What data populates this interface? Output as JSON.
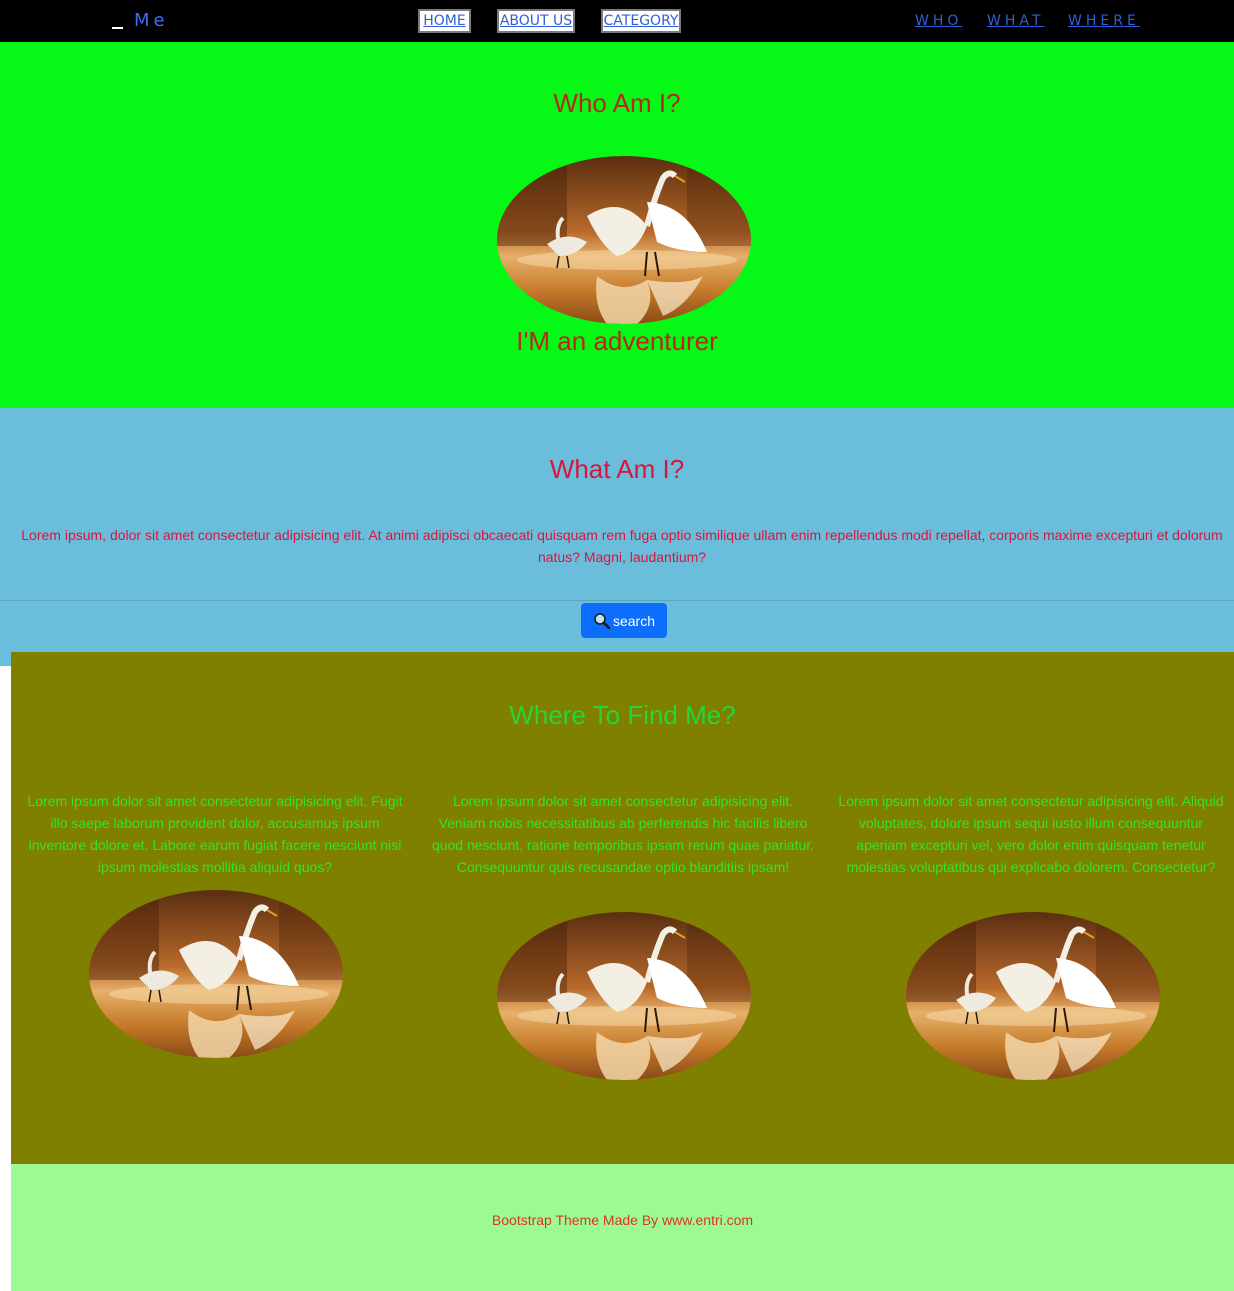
{
  "navbar": {
    "brand": "Me",
    "buttons": [
      "HOME",
      "ABOUT US",
      "CATEGORY"
    ],
    "links": [
      "WHO",
      "WHAT",
      "WHERE"
    ]
  },
  "who": {
    "heading": "Who Am I?",
    "image": "egrets-oval-image",
    "tagline": "I'M an adventurer"
  },
  "what": {
    "heading": "What Am I?",
    "text": "Lorem ipsum, dolor sit amet consectetur adipisicing elit. At animi adipisci obcaecati quisquam rem fuga optio similique ullam enim repellendus modi repellat, corporis maxime excepturi et dolorum natus? Magni, laudantium?",
    "search_label": "search",
    "search_icon": "magnifier-icon"
  },
  "where": {
    "heading": "Where To Find Me?",
    "columns": [
      {
        "text": "Lorem ipsum dolor sit amet consectetur adipisicing elit. Fugit illo saepe laborum provident dolor, accusamus ipsum inventore dolore et. Labore earum fugiat facere nesciunt nisi ipsum molestias mollitia aliquid quos?"
      },
      {
        "text": "Lorem ipsum dolor sit amet consectetur adipisicing elit. Veniam nobis necessitatibus ab perferendis hic facilis libero quod nesciunt, ratione temporibus ipsam rerum quae pariatur. Consequuntur quis recusandae optio blanditiis ipsam!"
      },
      {
        "text": "Lorem ipsum dolor sit amet consectetur adipisicing elit. Aliquid voluptates, dolore ipsum sequi iusto illum consequuntur aperiam excepturi vel, vero dolor enim quisquam tenetur molestias voluptatibus qui explicabo dolorem. Consectetur?"
      }
    ]
  },
  "footer": {
    "text": "Bootstrap Theme Made By www.entri.com"
  },
  "colors": {
    "navbar_bg": "#000000",
    "who_bg": "#06f916",
    "what_bg": "#6bbedb",
    "where_bg": "#7f7f00",
    "footer_bg": "#9cf993",
    "search_button": "#0d6efd"
  }
}
